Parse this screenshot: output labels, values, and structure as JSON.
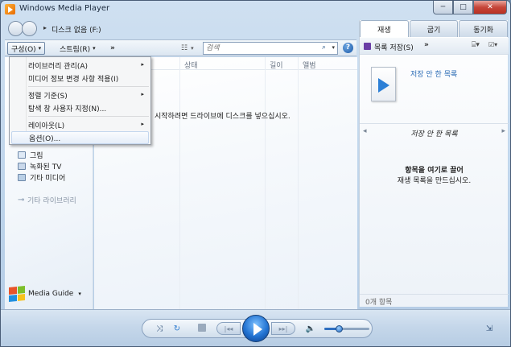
{
  "window": {
    "title": "Windows Media Player",
    "controls": {
      "minimize": "─",
      "maximize": "□",
      "close": "✕"
    }
  },
  "nav": {
    "back_icon": "back-arrow-icon",
    "forward_icon": "forward-arrow-icon",
    "breadcrumb_arrow": "▸",
    "breadcrumb": "디스크 없음 (F:)"
  },
  "toolbar": {
    "organize": "구성(O)",
    "stream": "스트림(R)",
    "more": "»",
    "dropdown_arrow": "▾",
    "view_icon": "☷",
    "search_placeholder": "검색",
    "search_icon": "⌕",
    "help_icon": "?"
  },
  "organize_menu": {
    "items": [
      {
        "label": "라이브러리 관리(A)",
        "has_submenu": true
      },
      {
        "label": "미디어 정보 변경 사항 적용(I)",
        "has_submenu": false
      },
      {
        "label": "정렬 기준(S)",
        "has_submenu": true
      },
      {
        "label": "탐색 창 사용자 지정(N)...",
        "has_submenu": false
      },
      {
        "label": "레이아웃(L)",
        "has_submenu": true
      },
      {
        "label": "옵션(O)...",
        "has_submenu": false,
        "highlighted": true
      }
    ],
    "submenu_arrow": "▸"
  },
  "library_tree": [
    {
      "label": "그림",
      "icon": "picture-icon"
    },
    {
      "label": "녹화된 TV",
      "icon": "tv-icon"
    },
    {
      "label": "기타 미디어",
      "icon": "media-icon"
    },
    {
      "label": "기타 라이브러리",
      "icon": "other-library-icon"
    }
  ],
  "media_guide": {
    "label": "Media Guide",
    "arrow": "▾"
  },
  "content": {
    "columns": [
      "상태",
      "길이",
      "앨범"
    ],
    "empty_message": "시작하려면 드라이브에 디스크를 넣으십시오."
  },
  "right_pane": {
    "tabs": [
      "재생",
      "굽기",
      "동기화"
    ],
    "active_tab": 0,
    "save_list": "목록 저장(S)",
    "more": "»",
    "unsaved_title": "저장 안 한 목록",
    "unsaved_list": "저장 안 한 목록",
    "nav_left": "◂",
    "nav_right": "▸",
    "drag_line1": "항목을 여기로 끌어",
    "drag_line2": "재생 목록을 만드십시오.",
    "item_count": "0개 항목"
  },
  "player": {
    "shuffle_icon": "⤨",
    "repeat_icon": "↻",
    "prev_icon": "|◂◂",
    "next_icon": "▸▸|",
    "mute_icon": "🔈",
    "volume": 0.33,
    "switch_icon": "⇲"
  },
  "colors": {
    "accent": "#2273d2",
    "link_text": "#2b6bb5"
  }
}
